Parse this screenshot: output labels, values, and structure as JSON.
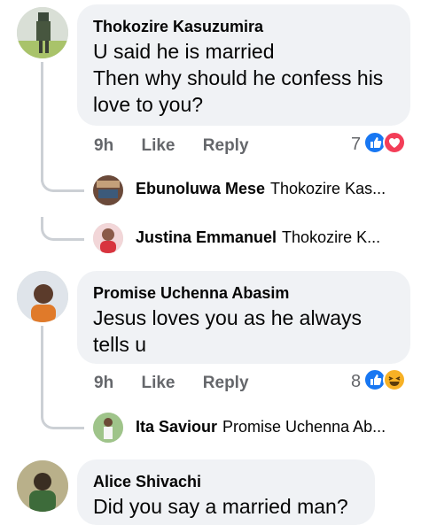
{
  "colors": {
    "bubble": "#f0f2f5",
    "meta_text": "#65676b",
    "like_blue": "#1877f2",
    "love_red": "#f33e58",
    "haha_yellow": "#f7b125"
  },
  "comments": [
    {
      "author": "Thokozire Kasuzumira",
      "text_lines": [
        "U said he is married",
        "Then why should he confess his",
        "love to you?"
      ],
      "time": "9h",
      "like_label": "Like",
      "reply_label": "Reply",
      "reaction_count": "7",
      "reactions": [
        "like-icon",
        "love-icon"
      ],
      "replies": [
        {
          "name": "Ebunoluwa Mese",
          "preview": "Thokozire Kas..."
        },
        {
          "name": "Justina Emmanuel",
          "preview": "Thokozire K..."
        }
      ]
    },
    {
      "author": "Promise Uchenna Abasim",
      "text_lines": [
        "Jesus loves you as he always",
        "tells u"
      ],
      "time": "9h",
      "like_label": "Like",
      "reply_label": "Reply",
      "reaction_count": "8",
      "reactions": [
        "like-icon",
        "haha-icon"
      ],
      "replies": [
        {
          "name": "Ita Saviour",
          "preview": "Promise Uchenna Ab..."
        }
      ]
    },
    {
      "author": "Alice Shivachi",
      "text_lines": [
        "Did you say a married man?"
      ]
    }
  ]
}
